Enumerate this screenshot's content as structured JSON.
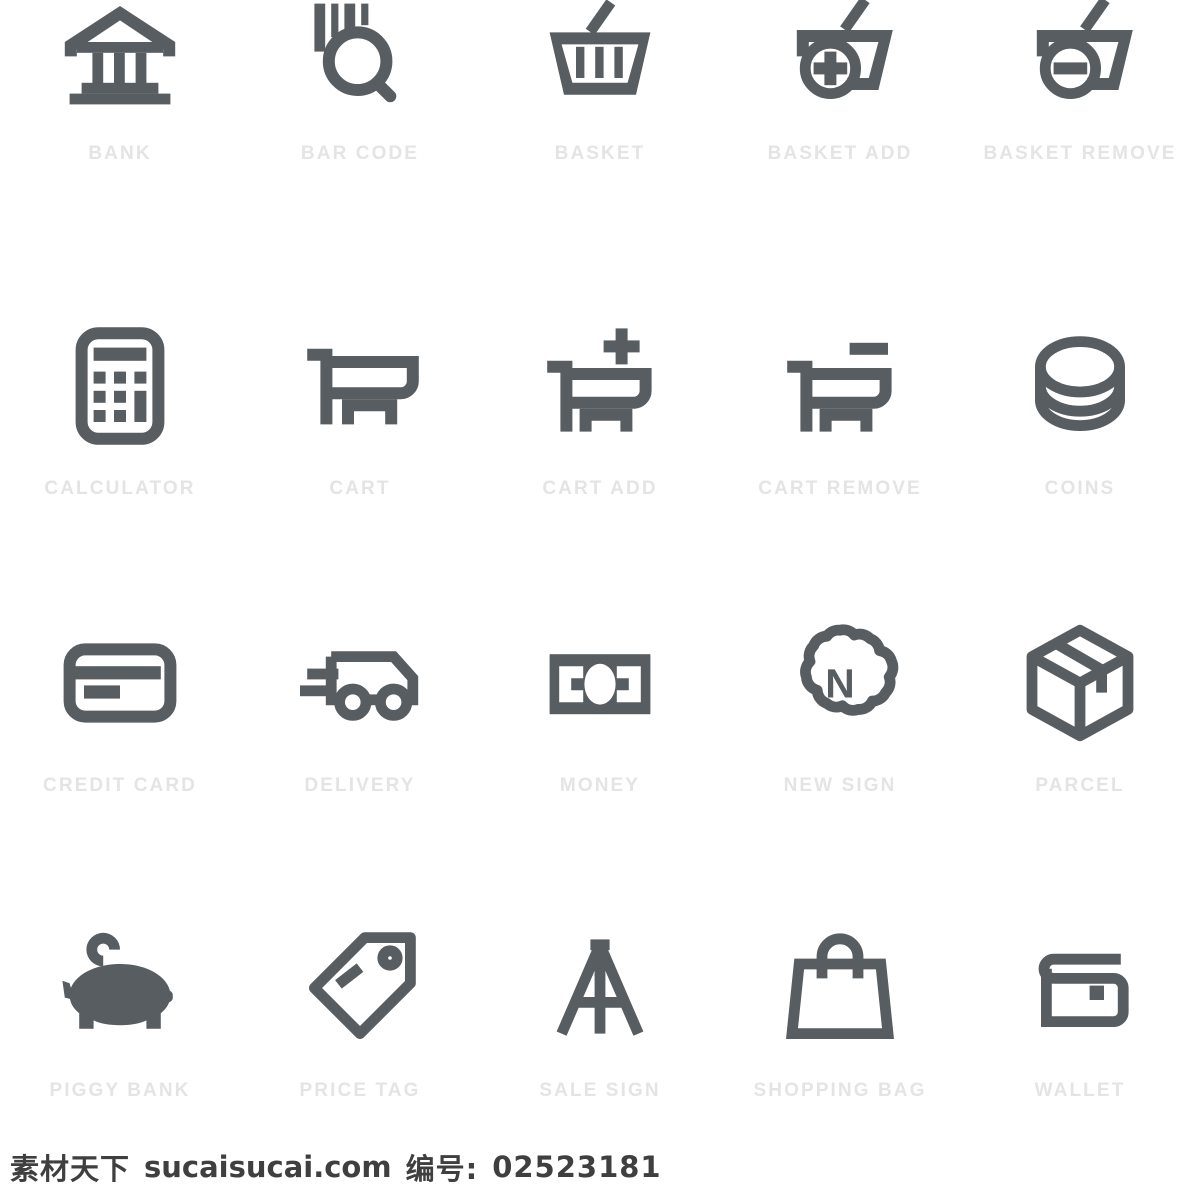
{
  "sheet": {
    "title": "E-commerce / Shopping Icon Set",
    "columns": 5,
    "rows": 4,
    "icon_color": "#575d60",
    "label_color": "#e4e4e4",
    "background": "#ffffff"
  },
  "icons": [
    {
      "label": "BANK",
      "icon_name": "bank-icon"
    },
    {
      "label": "BAR CODE",
      "icon_name": "bar-code-icon"
    },
    {
      "label": "BASKET",
      "icon_name": "basket-icon"
    },
    {
      "label": "BASKET ADD",
      "icon_name": "basket-add-icon"
    },
    {
      "label": "BASKET REMOVE",
      "icon_name": "basket-remove-icon"
    },
    {
      "label": "CALCULATOR",
      "icon_name": "calculator-icon"
    },
    {
      "label": "CART",
      "icon_name": "cart-icon"
    },
    {
      "label": "CART ADD",
      "icon_name": "cart-add-icon"
    },
    {
      "label": "CART REMOVE",
      "icon_name": "cart-remove-icon"
    },
    {
      "label": "COINS",
      "icon_name": "coins-icon"
    },
    {
      "label": "CREDIT CARD",
      "icon_name": "credit-card-icon"
    },
    {
      "label": "DELIVERY",
      "icon_name": "delivery-icon"
    },
    {
      "label": "MONEY",
      "icon_name": "money-icon"
    },
    {
      "label": "NEW SIGN",
      "icon_name": "new-sign-icon"
    },
    {
      "label": "PARCEL",
      "icon_name": "parcel-icon"
    },
    {
      "label": "PIGGY BANK",
      "icon_name": "piggy-bank-icon"
    },
    {
      "label": "PRICE TAG",
      "icon_name": "price-tag-icon"
    },
    {
      "label": "SALE SIGN",
      "icon_name": "sale-sign-icon"
    },
    {
      "label": "SHOPPING BAG",
      "icon_name": "shopping-bag-icon"
    },
    {
      "label": "WALLET",
      "icon_name": "wallet-icon"
    }
  ],
  "watermark": {
    "site_cn": "素材天下",
    "site_url": "sucaisucai.com",
    "id_label": "编号:",
    "id_value": "02523181"
  },
  "new_sign_badge_letter": "N"
}
